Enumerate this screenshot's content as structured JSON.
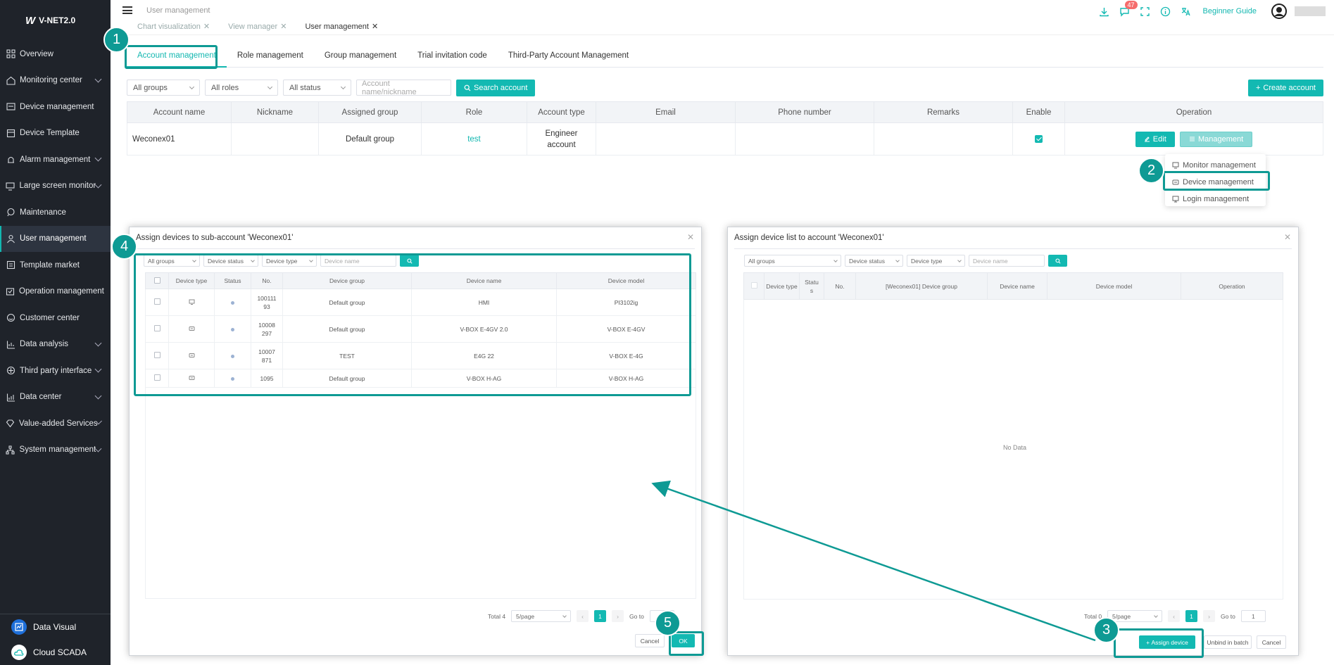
{
  "app": {
    "logo": "V-NET2.0"
  },
  "sidebar": {
    "items": [
      {
        "label": "Overview",
        "icon": "grid-icon",
        "chevron": false,
        "active": false
      },
      {
        "label": "Monitoring center",
        "icon": "monitor-house-icon",
        "chevron": true,
        "active": false
      },
      {
        "label": "Device management",
        "icon": "device-box-icon",
        "chevron": false,
        "active": false
      },
      {
        "label": "Device Template",
        "icon": "template-icon",
        "chevron": false,
        "active": false
      },
      {
        "label": "Alarm management",
        "icon": "alarm-icon",
        "chevron": true,
        "active": false
      },
      {
        "label": "Large screen monitor",
        "icon": "screen-icon",
        "chevron": true,
        "active": false
      },
      {
        "label": "Maintenance",
        "icon": "chat-icon",
        "chevron": false,
        "active": false
      },
      {
        "label": "User management",
        "icon": "user-icon",
        "chevron": false,
        "active": true
      },
      {
        "label": "Template market",
        "icon": "market-icon",
        "chevron": false,
        "active": false
      },
      {
        "label": "Operation management",
        "icon": "operation-icon",
        "chevron": false,
        "active": false
      },
      {
        "label": "Customer center",
        "icon": "customer-icon",
        "chevron": false,
        "active": false
      },
      {
        "label": "Data analysis",
        "icon": "analysis-icon",
        "chevron": true,
        "active": false
      },
      {
        "label": "Third party interface",
        "icon": "interface-icon",
        "chevron": true,
        "active": false
      },
      {
        "label": "Data center",
        "icon": "data-center-icon",
        "chevron": true,
        "active": false
      },
      {
        "label": "Value-added Services",
        "icon": "diamond-icon",
        "chevron": true,
        "active": false
      },
      {
        "label": "System management",
        "icon": "sitemap-icon",
        "chevron": true,
        "active": false
      }
    ],
    "bottom": [
      {
        "label": "Data Visual",
        "icon": "data-visual-icon",
        "color": "#1e6fd9"
      },
      {
        "label": "Cloud SCADA",
        "icon": "cloud-icon",
        "color": "#ffffff"
      }
    ]
  },
  "header": {
    "breadcrumb": "User management",
    "tabs": [
      {
        "label": "Chart visualization",
        "active": false
      },
      {
        "label": "View manager",
        "active": false
      },
      {
        "label": "User management",
        "active": true
      }
    ],
    "notification_count": "47",
    "beginner_guide": "Beginner Guide"
  },
  "page_tabs": [
    {
      "label": "Account management",
      "active": true
    },
    {
      "label": "Role management",
      "active": false
    },
    {
      "label": "Group management",
      "active": false
    },
    {
      "label": "Trial invitation code",
      "active": false
    },
    {
      "label": "Third-Party Account Management",
      "active": false
    }
  ],
  "filters": {
    "group": "All groups",
    "role": "All roles",
    "status": "All status",
    "search_placeholder": "Account name/nickname",
    "search_button": "Search account",
    "create_button": "Create account"
  },
  "accounts": {
    "columns": [
      "Account name",
      "Nickname",
      "Assigned group",
      "Role",
      "Account type",
      "Email",
      "Phone number",
      "Remarks",
      "Enable",
      "Operation"
    ],
    "rows": [
      {
        "name": "Weconex01",
        "nickname": "",
        "group": "Default group",
        "role": "test",
        "type": "Engineer account",
        "email": "",
        "phone": "",
        "remarks": "",
        "enabled": true
      }
    ],
    "edit_label": "Edit",
    "management_label": "Management"
  },
  "management_menu": [
    {
      "label": "Monitor management",
      "icon": "monitor-icon"
    },
    {
      "label": "Device management",
      "icon": "device-icon"
    },
    {
      "label": "Login management",
      "icon": "login-icon"
    }
  ],
  "assign_dialog": {
    "title": "Assign devices to sub-account 'Weconex01'",
    "filter_groups": "All groups",
    "filter_status": "Device status",
    "filter_type": "Device type",
    "filter_name_placeholder": "Device name",
    "columns": [
      "Device type",
      "Status",
      "No.",
      "Device group",
      "Device name",
      "Device model"
    ],
    "rows": [
      {
        "type_icon": "hmi-icon",
        "no": "10011193",
        "group": "Default group",
        "name": "HMI",
        "model": "PI3102ig"
      },
      {
        "type_icon": "box-icon",
        "no": "10008297",
        "group": "Default group",
        "name": "V-BOX E-4GV 2.0",
        "model": "V-BOX E-4GV"
      },
      {
        "type_icon": "box-icon",
        "no": "10007871",
        "group": "TEST",
        "name": "E4G 22",
        "model": "V-BOX E-4G"
      },
      {
        "type_icon": "box-icon",
        "no": "1095",
        "group": "Default group",
        "name": "V-BOX H-AG",
        "model": "V-BOX H-AG"
      }
    ],
    "total": "Total 4",
    "page_size": "5/page",
    "page": "1",
    "goto_label": "Go to",
    "cancel": "Cancel",
    "ok": "OK"
  },
  "list_dialog": {
    "title": "Assign device list to account 'Weconex01'",
    "filter_groups": "All groups",
    "filter_status": "Device status",
    "filter_type": "Device type",
    "filter_name_placeholder": "Device name",
    "columns": [
      "Device type",
      "Statu s",
      "No.",
      "[Weconex01] Device group",
      "Device name",
      "Device model",
      "Operation"
    ],
    "no_data": "No Data",
    "total": "Total 0",
    "page_size": "5/page",
    "page": "1",
    "goto_label": "Go to",
    "goto_value": "1",
    "assign_button": "Assign device",
    "unbind_button": "Unbind in batch",
    "cancel": "Cancel"
  },
  "callouts": [
    "1",
    "2",
    "3",
    "4",
    "5"
  ],
  "colors": {
    "accent": "#13b9b2",
    "callout": "#0e9a94",
    "sidebar_bg": "#1f232a",
    "badge": "#f56c6c"
  }
}
